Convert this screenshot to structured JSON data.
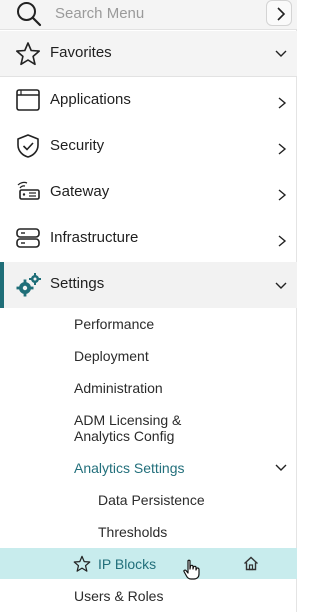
{
  "search": {
    "placeholder": "Search Menu"
  },
  "favorites": {
    "label": "Favorites"
  },
  "menu": [
    {
      "label": "Applications"
    },
    {
      "label": "Security"
    },
    {
      "label": "Gateway"
    },
    {
      "label": "Infrastructure"
    },
    {
      "label": "Settings"
    }
  ],
  "settings_children": {
    "performance": "Performance",
    "deployment": "Deployment",
    "administration": "Administration",
    "adm_licensing_line1": "ADM Licensing &",
    "adm_licensing_line2": "Analytics Config",
    "analytics_settings": "Analytics Settings",
    "users_roles": "Users & Roles"
  },
  "analytics_children": {
    "data_persistence": "Data Persistence",
    "thresholds": "Thresholds",
    "ip_blocks": "IP Blocks"
  },
  "colors": {
    "accent": "#1f6e78",
    "selected_bg": "#c8eced",
    "text": "#1f1f1f"
  }
}
